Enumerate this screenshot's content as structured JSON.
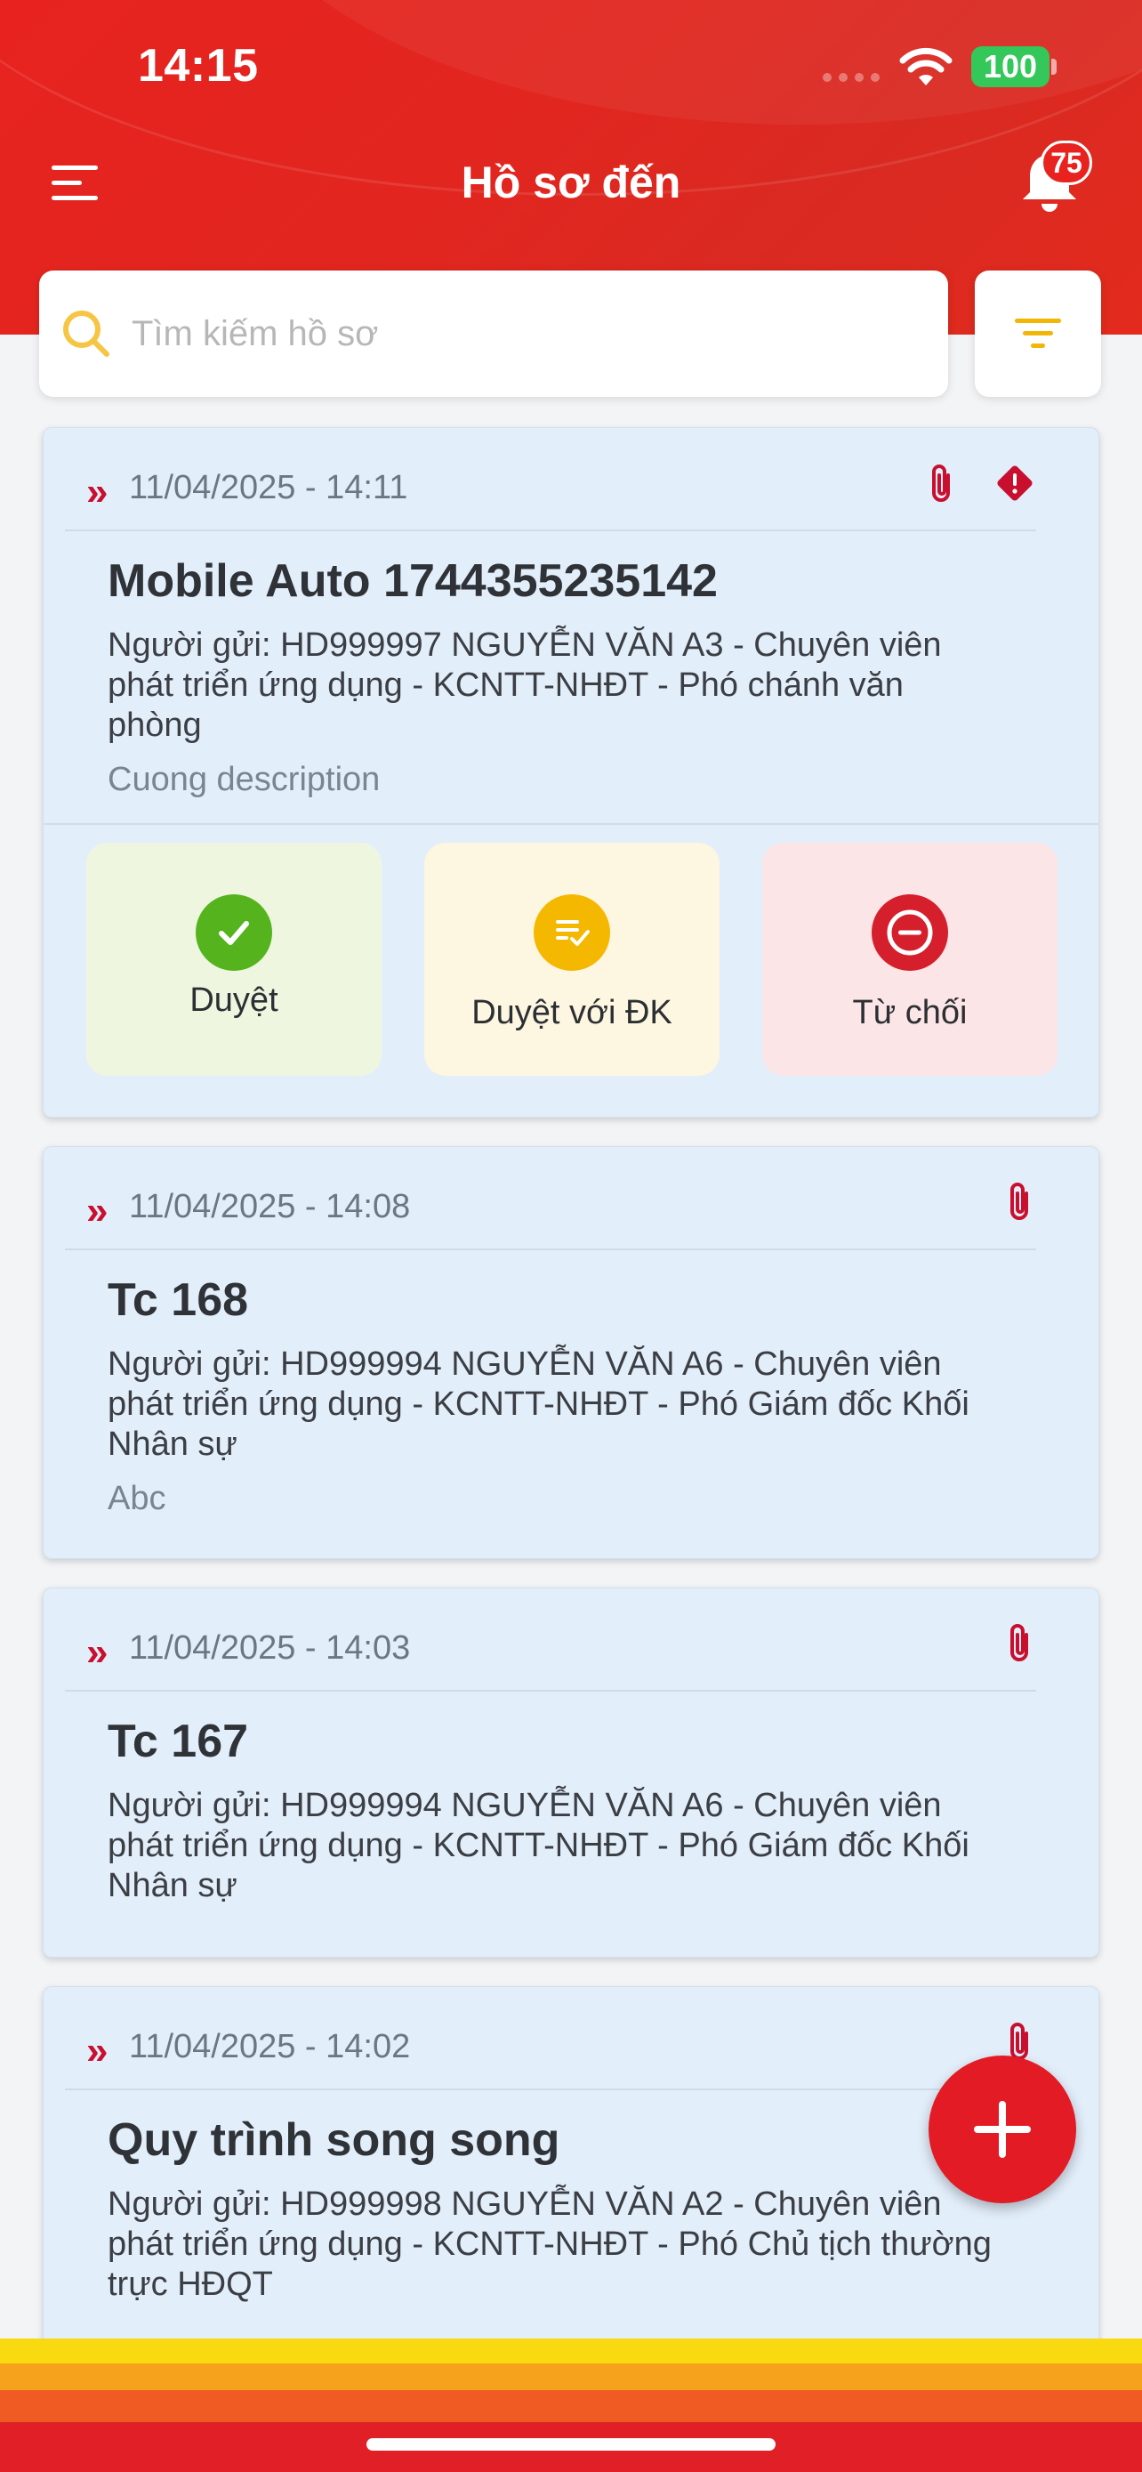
{
  "status_bar": {
    "time": "14:15",
    "battery": "100"
  },
  "header": {
    "title": "Hồ sơ đến",
    "notification_count": "75"
  },
  "search": {
    "placeholder": "Tìm kiếm hồ sơ",
    "value": ""
  },
  "colors": {
    "brand_red": "#e8231f",
    "card_bg": "#e3eefb",
    "approve": "#55b41d",
    "approve_cond": "#f5b800",
    "reject": "#d61f2c"
  },
  "cards": [
    {
      "datetime": "11/04/2025 - 14:11",
      "title": "Mobile Auto 1744355235142",
      "sender_line1": "Người gửi: HD999997 NGUYỄN VĂN A3 - Chuyên viên",
      "sender_line2": "phát triển ứng dụng - KCNTT-NHĐT - Phó chánh văn",
      "sender_line3": "phòng",
      "description": "Cuong description",
      "icons": [
        "paperclip-icon",
        "priority-icon"
      ],
      "actions": {
        "approve": "Duyệt",
        "approve_conditional": "Duyệt với ĐK",
        "reject": "Từ chối"
      }
    },
    {
      "datetime": "11/04/2025 - 14:08",
      "title": "Tc 168",
      "sender_line1": "Người gửi: HD999994 NGUYỄN VĂN A6 - Chuyên viên",
      "sender_line2": "phát triển ứng dụng - KCNTT-NHĐT - Phó Giám đốc Khối",
      "sender_line3": "Nhân sự",
      "description": "Abc",
      "icons": [
        "paperclip-icon"
      ]
    },
    {
      "datetime": "11/04/2025 - 14:03",
      "title": "Tc 167",
      "sender_line1": "Người gửi: HD999994 NGUYỄN VĂN A6 - Chuyên viên",
      "sender_line2": "phát triển ứng dụng - KCNTT-NHĐT - Phó Giám đốc Khối",
      "sender_line3": "Nhân sự",
      "icons": [
        "paperclip-icon"
      ]
    },
    {
      "datetime": "11/04/2025 - 14:02",
      "title": "Quy trình song song",
      "sender_line1": "Người gửi: HD999998 NGUYỄN VĂN A2 - Chuyên viên",
      "sender_line2": "phát triển ứng dụng - KCNTT-NHĐT - Phó Chủ tịch thường",
      "sender_line3": "trực HĐQT",
      "icons": [
        "paperclip-icon"
      ]
    }
  ]
}
